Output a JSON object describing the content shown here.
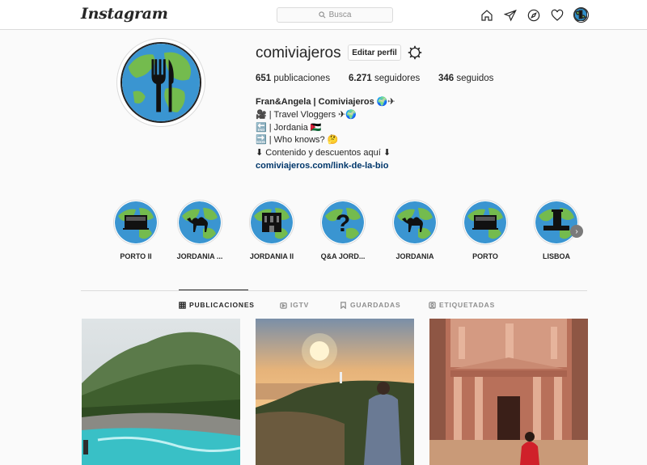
{
  "header": {
    "logo": "Instagram",
    "search_placeholder": "Busca",
    "icons": [
      "home-icon",
      "direct-icon",
      "explore-icon",
      "activity-heart-icon",
      "profile-avatar"
    ]
  },
  "profile": {
    "username": "comiviajeros",
    "edit_label": "Editar perfil",
    "stats": {
      "posts_count": "651",
      "posts_label": "publicaciones",
      "followers_count": "6.271",
      "followers_label": "seguidores",
      "following_count": "346",
      "following_label": "seguidos"
    },
    "bio": {
      "name": "Fran&Angela | Comiviajeros 🌍✈",
      "line1": "🎥 | Travel Vloggers ✈🌍",
      "line2": "🔚 | Jordania 🇯🇴",
      "line3": "🔜 | Who knows? 🤔",
      "line4": "⬇ Contenido y descuentos aquí ⬇",
      "link": "comiviajeros.com/link-de-la-bio"
    }
  },
  "highlights": [
    {
      "label": "PORTO II",
      "icon": "tram-icon"
    },
    {
      "label": "JORDANIA ...",
      "icon": "camel-icon"
    },
    {
      "label": "JORDANIA II",
      "icon": "petra-icon"
    },
    {
      "label": "Q&A JORD...",
      "icon": "question-icon"
    },
    {
      "label": "JORDANIA",
      "icon": "camel-icon"
    },
    {
      "label": "PORTO",
      "icon": "tram-icon"
    },
    {
      "label": "LISBOA",
      "icon": "tower-icon"
    }
  ],
  "tabs": [
    {
      "label": "PUBLICACIONES",
      "icon": "grid-icon",
      "active": true
    },
    {
      "label": "IGTV",
      "icon": "igtv-icon",
      "active": false
    },
    {
      "label": "GUARDADAS",
      "icon": "bookmark-icon",
      "active": false
    },
    {
      "label": "ETIQUETADAS",
      "icon": "tag-icon",
      "active": false
    }
  ],
  "colors": {
    "link": "#00376b",
    "border": "#dbdbdb",
    "text": "#262626",
    "muted": "#8e8e8e"
  }
}
